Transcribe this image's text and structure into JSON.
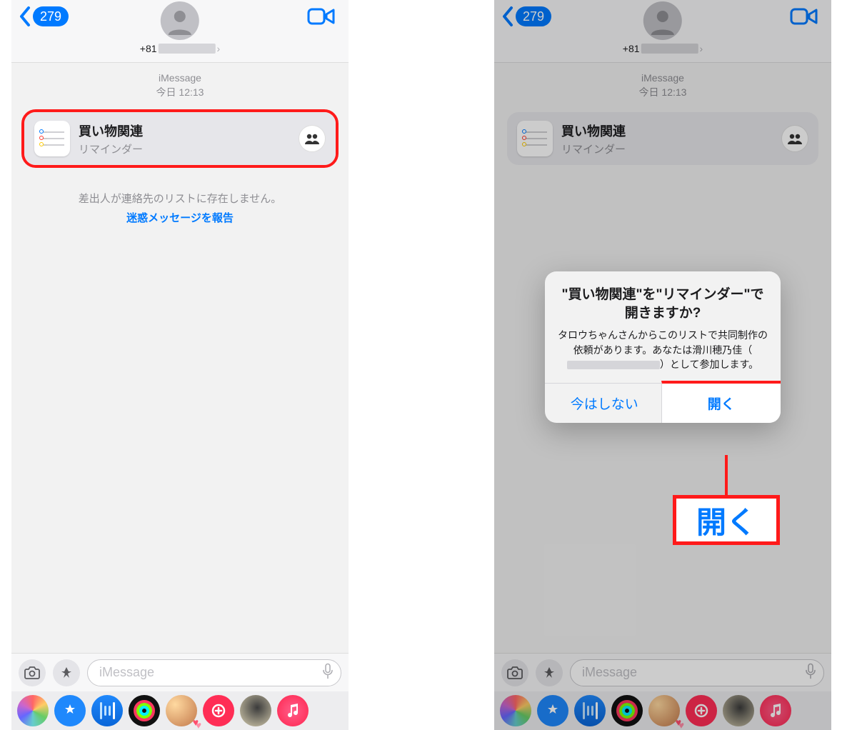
{
  "header": {
    "back_count": "279",
    "phone_prefix": "+81",
    "facetime_icon": "video"
  },
  "thread": {
    "service": "iMessage",
    "datetime": "今日 12:13"
  },
  "reminder": {
    "title": "買い物関連",
    "subtitle": "リマインダー"
  },
  "notice": {
    "line1": "差出人が連絡先のリストに存在しません。",
    "report_link": "迷惑メッセージを報告"
  },
  "alert": {
    "title": "\"買い物関連\"を\"リマインダー\"で開きますか?",
    "msg_part1": "タロウちゃんさんからこのリストで共同制作の依頼があります。あなたは滑川穂乃佳（",
    "msg_part2": "）として参加します。",
    "btn_cancel": "今はしない",
    "btn_open": "開く"
  },
  "callout": {
    "open_big": "開く"
  },
  "input": {
    "placeholder": "iMessage"
  }
}
